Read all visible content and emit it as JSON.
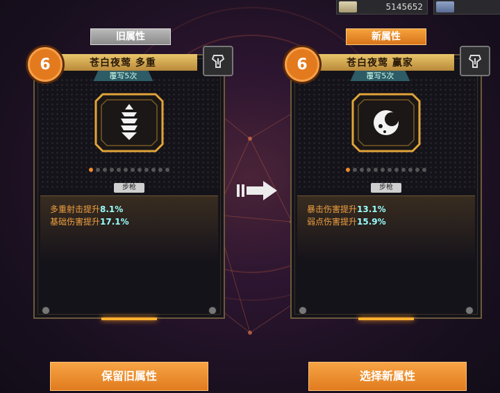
{
  "resources": {
    "money": "5145652"
  },
  "old": {
    "tag": "旧属性",
    "level": "6",
    "title": "苍白夜莺 多重",
    "subtitle": "覆写5次",
    "weapon_type": "步枪",
    "stats": [
      {
        "name": "多重射击提升",
        "value": "8.1%"
      },
      {
        "name": "基础伤害提升",
        "value": "17.1%"
      }
    ]
  },
  "new": {
    "tag": "新属性",
    "level": "6",
    "title": "苍白夜莺 赢家",
    "subtitle": "覆写5次",
    "weapon_type": "步枪",
    "stats": [
      {
        "name": "暴击伤害提升",
        "value": "13.1%"
      },
      {
        "name": "弱点伤害提升",
        "value": "15.9%"
      }
    ]
  },
  "buttons": {
    "keep": "保留旧属性",
    "choose": "选择新属性"
  },
  "colors": {
    "accent": "#f08a2a",
    "stat_value": "#99ffff",
    "stat_label": "#f0a040"
  }
}
